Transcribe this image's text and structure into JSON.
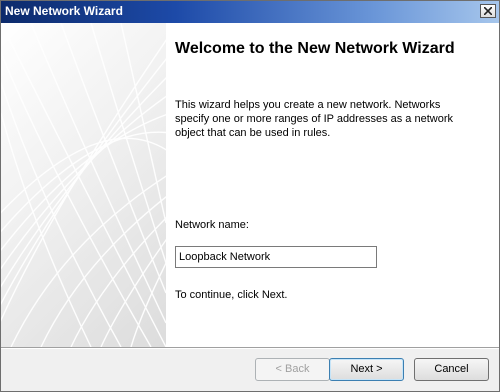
{
  "window": {
    "title": "New Network Wizard"
  },
  "main": {
    "heading": "Welcome to the New Network Wizard",
    "description": "This wizard helps you create a new network. Networks specify one or more ranges of IP addresses as a network object that can be used in rules.",
    "network_name_label": "Network name:",
    "network_name_value": "Loopback Network",
    "continue_text": "To continue, click Next."
  },
  "buttons": {
    "back": "< Back",
    "next": "Next >",
    "cancel": "Cancel"
  },
  "icons": {
    "close": "close-icon"
  }
}
